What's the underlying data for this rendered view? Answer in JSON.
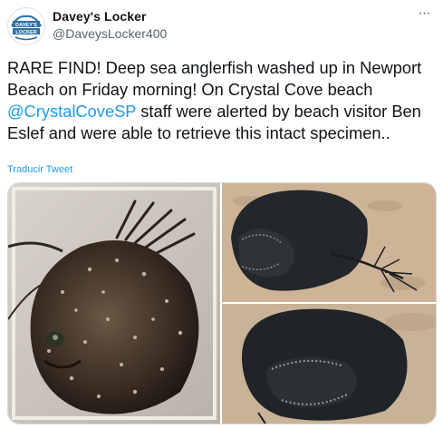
{
  "tweet": {
    "display_name": "Davey's Locker",
    "handle": "@DaveysLocker400",
    "avatar_text": "DAVEY'S LOCKER",
    "text_before": "RARE FIND! Deep sea anglerfish washed up in Newport Beach on Friday morning! On Crystal Cove beach ",
    "mention": "@CrystalCoveSP",
    "text_after": " staff were alerted by beach visitor Ben Eslef and were able to retrieve this intact specimen..",
    "translate_label": "Traducir Tweet",
    "more_glyph": "···"
  },
  "colors": {
    "link": "#1d9bf0",
    "secondary_text": "#536471",
    "border": "#cfd9de"
  },
  "media": {
    "photo_count": 3,
    "photos": [
      "anglerfish-in-tray-photo",
      "anglerfish-on-sand-photo",
      "anglerfish-mouth-closeup-photo"
    ]
  }
}
